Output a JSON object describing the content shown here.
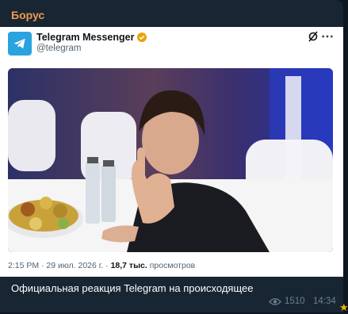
{
  "message": {
    "sender": "Борус",
    "caption": "Официальная реакция Telegram на происходящее",
    "views": "1510",
    "time": "14:34"
  },
  "tweet": {
    "name": "Telegram Messenger",
    "handle": "@telegram",
    "date": "2:15 PM · 29 июл. 2026 г. · ",
    "views_count": "18,7 тыс.",
    "views_label": " просмотров"
  },
  "icons": {
    "avatar": "telegram-logo-icon",
    "verified": "verified-badge-icon",
    "x": "x-logo-icon",
    "more": "more-icon",
    "views": "eye-icon",
    "star": "star-icon"
  },
  "colors": {
    "sender": "#ee9a4f",
    "telegram_blue": "#2aa3de",
    "verified_gold": "#e8a20e"
  }
}
